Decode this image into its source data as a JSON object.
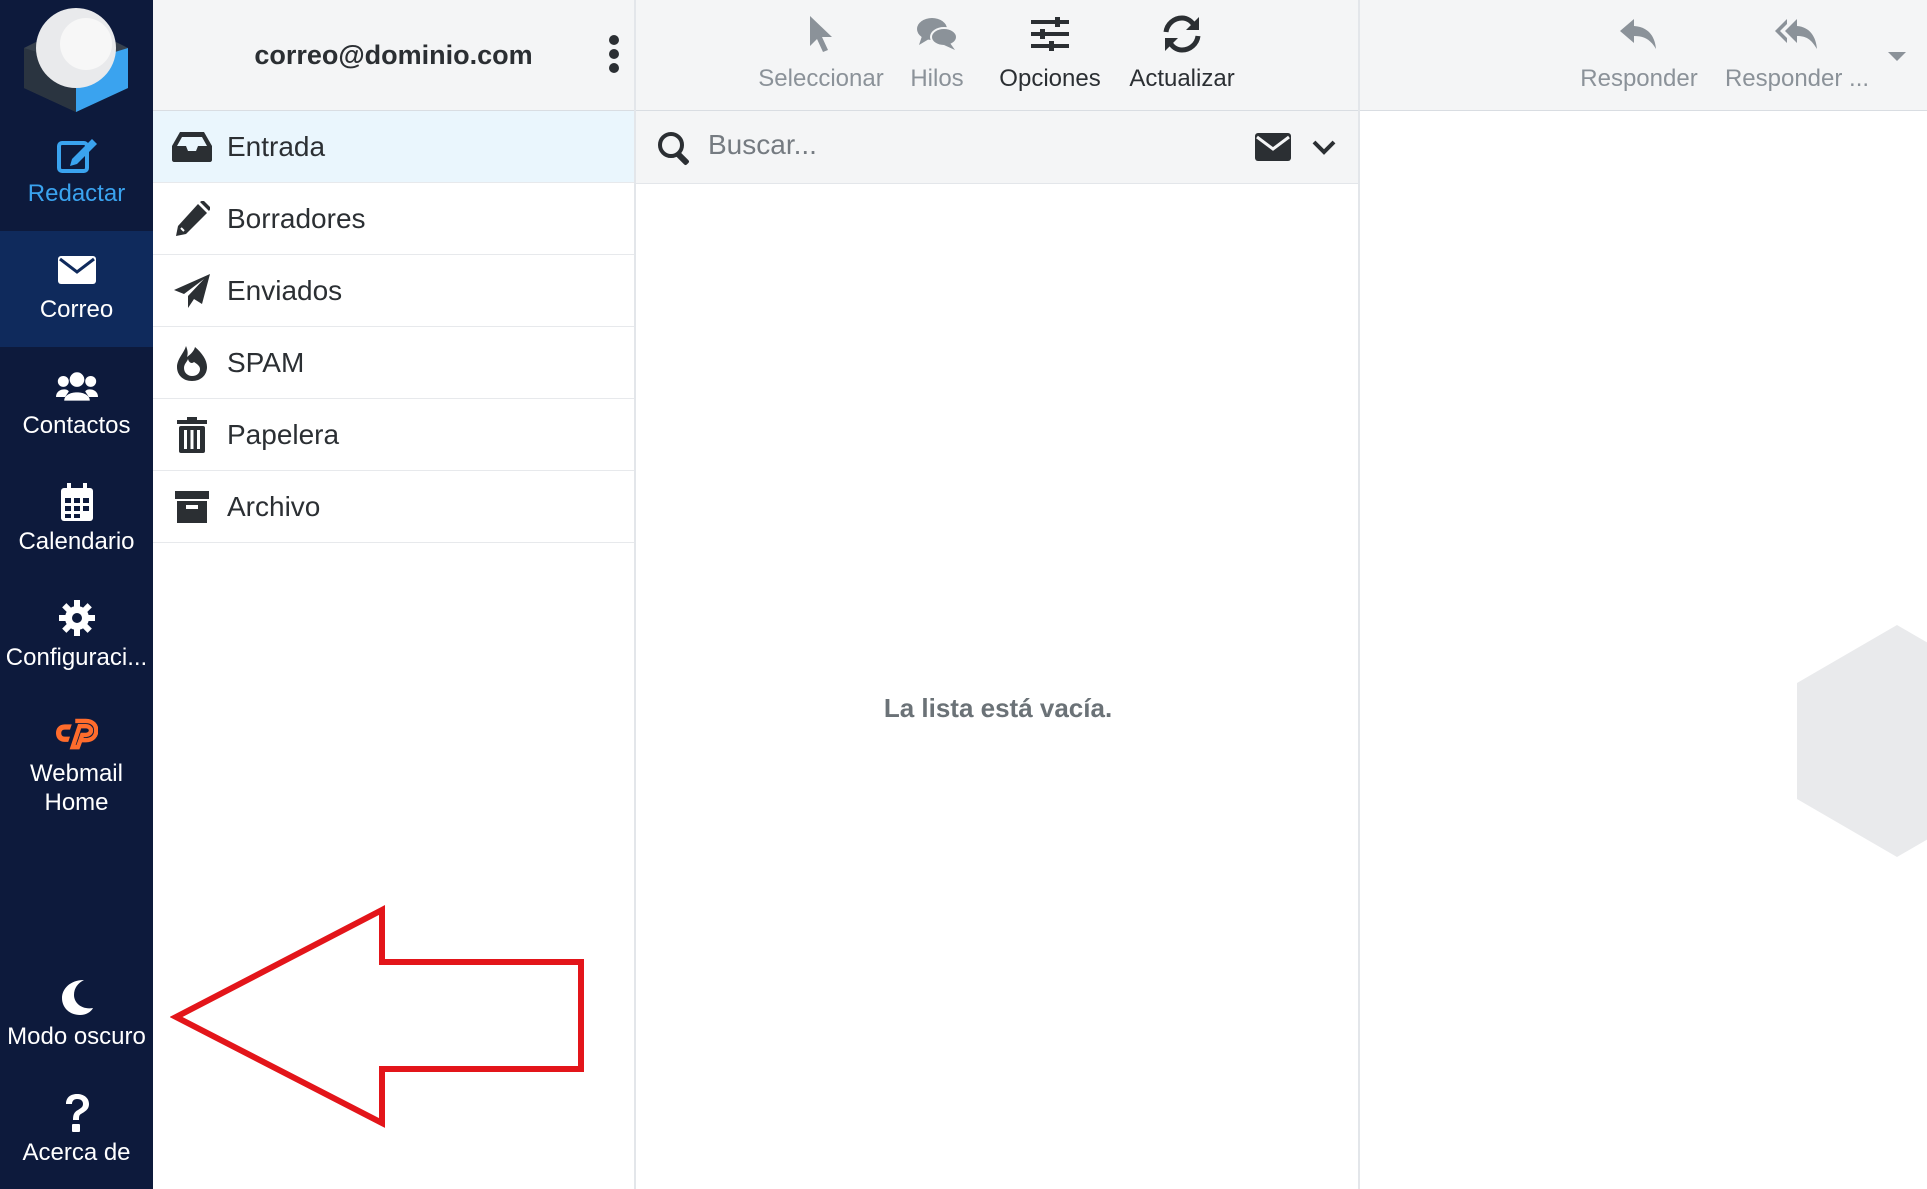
{
  "nav": {
    "logo_icon": "roundcube-logo",
    "items": [
      {
        "label": "Redactar",
        "icon": "compose-icon"
      },
      {
        "label": "Correo",
        "icon": "envelope-icon"
      },
      {
        "label": "Contactos",
        "icon": "users-icon"
      },
      {
        "label": "Calendario",
        "icon": "calendar-icon"
      },
      {
        "label": "Configuraci...",
        "icon": "gear-icon"
      },
      {
        "label_line1": "Webmail",
        "label_line2": "Home",
        "icon": "cpanel-icon"
      },
      {
        "label": "Modo oscuro",
        "icon": "moon-icon"
      },
      {
        "label": "Acerca de",
        "icon": "question-icon"
      }
    ],
    "colors": {
      "background": "#0d1a3c",
      "active": "#0f2a5c",
      "compose": "#3aa3ef",
      "cpanel": "#ff6c2c"
    }
  },
  "folders": {
    "account": "correo@dominio.com",
    "items": [
      {
        "label": "Entrada",
        "icon": "inbox-icon"
      },
      {
        "label": "Borradores",
        "icon": "pencil-icon"
      },
      {
        "label": "Enviados",
        "icon": "paper-plane-icon"
      },
      {
        "label": "SPAM",
        "icon": "fire-icon"
      },
      {
        "label": "Papelera",
        "icon": "trash-icon"
      },
      {
        "label": "Archivo",
        "icon": "archive-icon"
      }
    ]
  },
  "toolbar": {
    "select": "Seleccionar",
    "threads": "Hilos",
    "options": "Opciones",
    "refresh": "Actualizar"
  },
  "search": {
    "placeholder": "Buscar..."
  },
  "list": {
    "empty_message": "La lista está vacía."
  },
  "preview_toolbar": {
    "reply": "Responder",
    "reply_all": "Responder ..."
  },
  "annotation": {
    "color": "#e3151a",
    "icon": "arrow-left-icon"
  }
}
